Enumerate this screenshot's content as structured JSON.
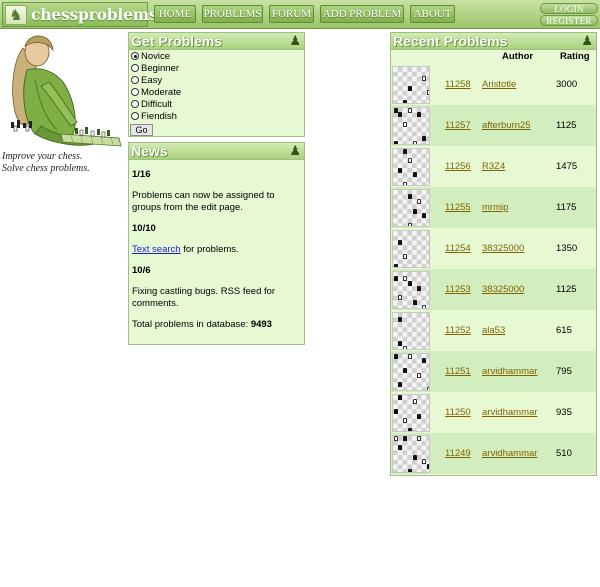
{
  "header": {
    "site_name": "chessproblems",
    "nav": [
      "HOME",
      "PROBLEMS",
      "FORUM",
      "ADD PROBLEM",
      "ABOUT"
    ],
    "login": "LOGIN",
    "register": "REGISTER"
  },
  "intro": {
    "line1": "Improve your chess.",
    "line2": "Solve chess problems."
  },
  "get_problems": {
    "title": "Get Problems",
    "options": [
      "Novice",
      "Beginner",
      "Easy",
      "Moderate",
      "Difficult",
      "Fiendish"
    ],
    "selected": "Novice",
    "go_label": "Go"
  },
  "news": {
    "title": "News",
    "items": [
      {
        "date": "1/16",
        "text": "Problems can now be assigned to groups from the edit page."
      },
      {
        "date": "10/10",
        "link": "Text search",
        "text": " for problems."
      },
      {
        "date": "10/6",
        "text": "Fixing castling bugs. RSS feed for comments."
      }
    ],
    "total_label": "Total problems in database: ",
    "total_value": "9493"
  },
  "recent": {
    "title": "Recent Problems",
    "author_header": "Author",
    "rating_header": "Rating",
    "rows": [
      {
        "id": "11258",
        "author": "Aristotle",
        "rating": "3000"
      },
      {
        "id": "11257",
        "author": "afterburn25",
        "rating": "1125"
      },
      {
        "id": "11256",
        "author": "R3Z4",
        "rating": "1475"
      },
      {
        "id": "11255",
        "author": "mrmip",
        "rating": "1175"
      },
      {
        "id": "11254",
        "author": "38325000",
        "rating": "1350"
      },
      {
        "id": "11253",
        "author": "38325000",
        "rating": "1125"
      },
      {
        "id": "11252",
        "author": "ala53",
        "rating": "615"
      },
      {
        "id": "11251",
        "author": "arvidhammar",
        "rating": "795"
      },
      {
        "id": "11250",
        "author": "arvidhammar",
        "rating": "935"
      },
      {
        "id": "11249",
        "author": "arvidhammar",
        "rating": "510"
      }
    ]
  },
  "icons": {
    "panel_pawn": "pawn-icon",
    "logo": "knight-icon"
  },
  "colors": {
    "brand_green": "#9cc66a",
    "panel_background": "#e6f9d2",
    "alt_row": "#d2eebe",
    "link_olive": "#806400",
    "news_link": "#1a1ad8"
  }
}
